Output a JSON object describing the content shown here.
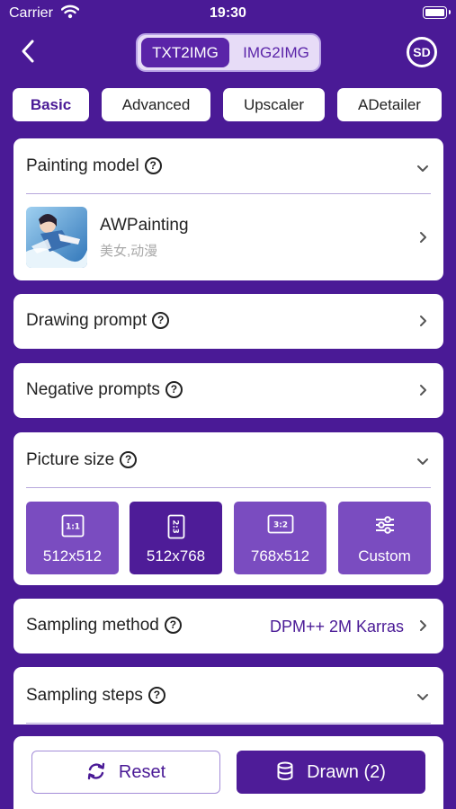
{
  "status_bar": {
    "carrier": "Carrier",
    "time": "19:30"
  },
  "nav": {
    "segments": [
      "TXT2IMG",
      "IMG2IMG"
    ],
    "active_segment": "TXT2IMG",
    "badge": "SD"
  },
  "tabs": [
    {
      "label": "Basic",
      "active": true
    },
    {
      "label": "Advanced",
      "active": false
    },
    {
      "label": "Upscaler",
      "active": false
    },
    {
      "label": "ADetailer",
      "active": false
    }
  ],
  "painting_model": {
    "title": "Painting model",
    "model_name": "AWPainting",
    "model_tags": "美女,动漫"
  },
  "drawing_prompt": {
    "title": "Drawing prompt"
  },
  "negative_prompts": {
    "title": "Negative prompts"
  },
  "picture_size": {
    "title": "Picture size",
    "options": [
      {
        "ratio": "1:1",
        "label": "512x512",
        "selected": false
      },
      {
        "ratio": "2:3",
        "label": "512x768",
        "selected": true
      },
      {
        "ratio": "3:2",
        "label": "768x512",
        "selected": false
      },
      {
        "ratio": "",
        "label": "Custom",
        "selected": false
      }
    ]
  },
  "sampling_method": {
    "title": "Sampling method",
    "value": "DPM++ 2M Karras"
  },
  "sampling_steps": {
    "title": "Sampling steps"
  },
  "actions": {
    "reset": "Reset",
    "drawn": "Drawn (2)"
  },
  "colors": {
    "background": "#4a1a96",
    "accent": "#5a24a8",
    "selected": "#4e1c98",
    "option": "#7a4cc0"
  },
  "icons": [
    "back-chevron-icon",
    "wifi-icon",
    "battery-icon",
    "help-icon",
    "chevron-down-icon",
    "chevron-right-icon",
    "sliders-icon",
    "refresh-icon",
    "database-icon"
  ]
}
